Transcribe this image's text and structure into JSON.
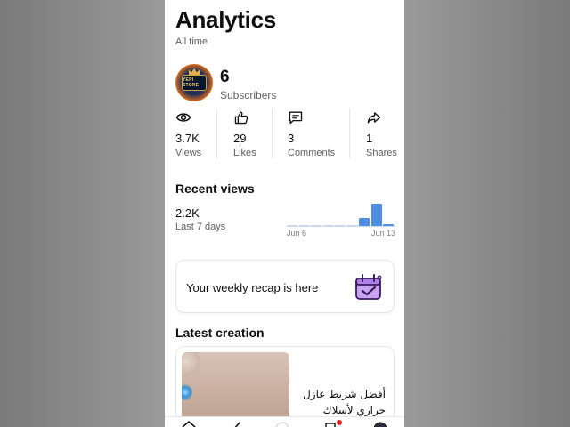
{
  "header": {
    "title": "Analytics",
    "subtitle": "All time"
  },
  "channel": {
    "avatar_text": "YEPI STORE",
    "subscribers_count": "6",
    "subscribers_label": "Subscribers"
  },
  "stats": [
    {
      "icon": "eye-icon",
      "value": "3.7K",
      "label": "Views"
    },
    {
      "icon": "thumbs-up-icon",
      "value": "29",
      "label": "Likes"
    },
    {
      "icon": "comment-icon",
      "value": "3",
      "label": "Comments"
    },
    {
      "icon": "share-icon",
      "value": "1",
      "label": "Shares"
    }
  ],
  "recent_views": {
    "title": "Recent views",
    "value": "2.2K",
    "period": "Last 7 days"
  },
  "chart_data": {
    "type": "bar",
    "categories": [
      "",
      "",
      "",
      "",
      "",
      "",
      "",
      "",
      ""
    ],
    "x_tick_labels": [
      "Jun 6",
      "Jun 13"
    ],
    "values": [
      0.03,
      0.03,
      0.03,
      0.03,
      0.03,
      0.03,
      0.28,
      0.82,
      0.06
    ],
    "highlight_from_index": 6,
    "ylim": [
      0,
      1
    ],
    "title": "",
    "xlabel": "",
    "ylabel": "",
    "colors": {
      "active": "#4f8ee0",
      "faint": "#c8d9f0"
    }
  },
  "recap": {
    "text": "Your weekly recap is here",
    "icon": "calendar-check-icon"
  },
  "latest_creation": {
    "title": "Latest creation",
    "video_title": "أفضل شريط عازل\nحراري لأسلاك الس..."
  },
  "colors": {
    "accent": "#4f8ee0",
    "text": "#0f0f0f",
    "muted": "#606060",
    "divider": "#e5e5e5",
    "notification": "#e02424"
  }
}
